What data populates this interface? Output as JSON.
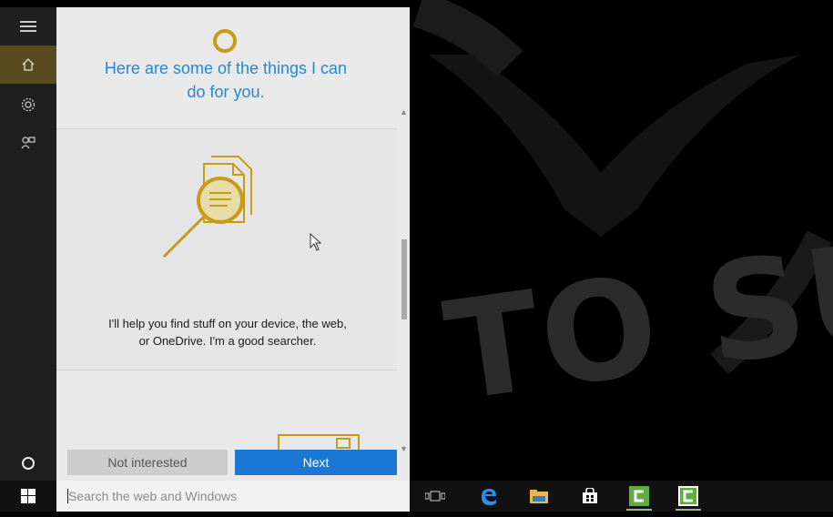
{
  "watermark": {
    "text": "TO SUCC"
  },
  "rail": {
    "items": [
      {
        "name": "menu",
        "icon": "hamburger-icon"
      },
      {
        "name": "home",
        "icon": "home-icon"
      },
      {
        "name": "settings",
        "icon": "gear-icon"
      },
      {
        "name": "feedback",
        "icon": "feedback-icon"
      }
    ],
    "bottom_icon": "cortana-circle-icon"
  },
  "panel": {
    "heading_line1": "Here are some of the things I can",
    "heading_line2": "do for you.",
    "card_text_line1": "I'll help you find stuff on your device, the web,",
    "card_text_line2": "or OneDrive. I'm a good searcher.",
    "accent_color": "#c59c16",
    "heading_color": "#1f8ad9"
  },
  "buttons": {
    "not_interested": "Not interested",
    "next": "Next"
  },
  "taskbar": {
    "search_placeholder": "Search the web and Windows",
    "icons": [
      "task-view-icon",
      "edge-icon",
      "file-explorer-icon",
      "store-icon",
      "camtasia-icon",
      "camtasia-icon"
    ]
  }
}
